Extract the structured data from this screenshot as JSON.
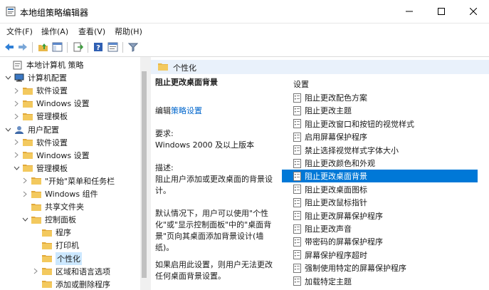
{
  "window": {
    "title": "本地组策略编辑器"
  },
  "menu": [
    "文件(F)",
    "操作(A)",
    "查看(V)",
    "帮助(H)"
  ],
  "toolbar": [
    "back-icon",
    "forward-icon",
    "up-folder-icon",
    "show-hide-tree-icon",
    "export-list-icon",
    "help-icon",
    "properties-icon",
    "filter-icon"
  ],
  "tree": [
    {
      "label": "本地计算机 策略",
      "level": 0,
      "chev": "none",
      "icon": "policy"
    },
    {
      "label": "计算机配置",
      "level": 1,
      "chev": "down",
      "icon": "computer"
    },
    {
      "label": "软件设置",
      "level": 2,
      "chev": "right",
      "icon": "folder"
    },
    {
      "label": "Windows 设置",
      "level": 2,
      "chev": "right",
      "icon": "folder"
    },
    {
      "label": "管理模板",
      "level": 2,
      "chev": "right",
      "icon": "folder"
    },
    {
      "label": "用户配置",
      "level": 1,
      "chev": "down",
      "icon": "user"
    },
    {
      "label": "软件设置",
      "level": 2,
      "chev": "right",
      "icon": "folder"
    },
    {
      "label": "Windows 设置",
      "level": 2,
      "chev": "right",
      "icon": "folder"
    },
    {
      "label": "管理模板",
      "level": 2,
      "chev": "down",
      "icon": "folder"
    },
    {
      "label": "\"开始\"菜单和任务栏",
      "level": 3,
      "chev": "right",
      "icon": "folder"
    },
    {
      "label": "Windows 组件",
      "level": 3,
      "chev": "right",
      "icon": "folder"
    },
    {
      "label": "共享文件夹",
      "level": 3,
      "chev": "none",
      "icon": "folder"
    },
    {
      "label": "控制面板",
      "level": 3,
      "chev": "down",
      "icon": "folder"
    },
    {
      "label": "程序",
      "level": 4,
      "chev": "none",
      "icon": "folder"
    },
    {
      "label": "打印机",
      "level": 4,
      "chev": "none",
      "icon": "folder"
    },
    {
      "label": "个性化",
      "level": 4,
      "chev": "none",
      "icon": "folder",
      "selected": true
    },
    {
      "label": "区域和语言选项",
      "level": 4,
      "chev": "right",
      "icon": "folder"
    },
    {
      "label": "添加或删除程序",
      "level": 4,
      "chev": "none",
      "icon": "folder"
    }
  ],
  "right_header": "个性化",
  "desc": {
    "title": "阻止更改桌面背景",
    "edit_prefix": "编辑",
    "edit_link": "策略设置",
    "req_label": "要求:",
    "req_value": "Windows 2000 及以上版本",
    "desc_label": "描述:",
    "desc_lines": [
      "阻止用户添加或更改桌面的背景设",
      "计。"
    ],
    "default_lines": [
      "默认情况下，用户可以使用\"个性",
      "化\"或\"显示控制面板\"中的\"桌面背",
      "景\"页向其桌面添加背景设计(墙",
      "纸)。"
    ],
    "enable_lines": [
      "如果启用此设置，则用户无法更改",
      "任何桌面背景设置。"
    ]
  },
  "settings_header": "设置",
  "settings": [
    "阻止更改配色方案",
    "阻止更改主题",
    "阻止更改窗口和按钮的视觉样式",
    "启用屏幕保护程序",
    "禁止选择视觉样式字体大小",
    "阻止更改颜色和外观",
    "阻止更改桌面背景",
    "阻止更改桌面图标",
    "阻止更改鼠标指针",
    "阻止更改屏幕保护程序",
    "阻止更改声音",
    "带密码的屏幕保护程序",
    "屏幕保护程序超时",
    "强制使用特定的屏幕保护程序",
    "加载特定主题"
  ],
  "selected_setting": 6
}
